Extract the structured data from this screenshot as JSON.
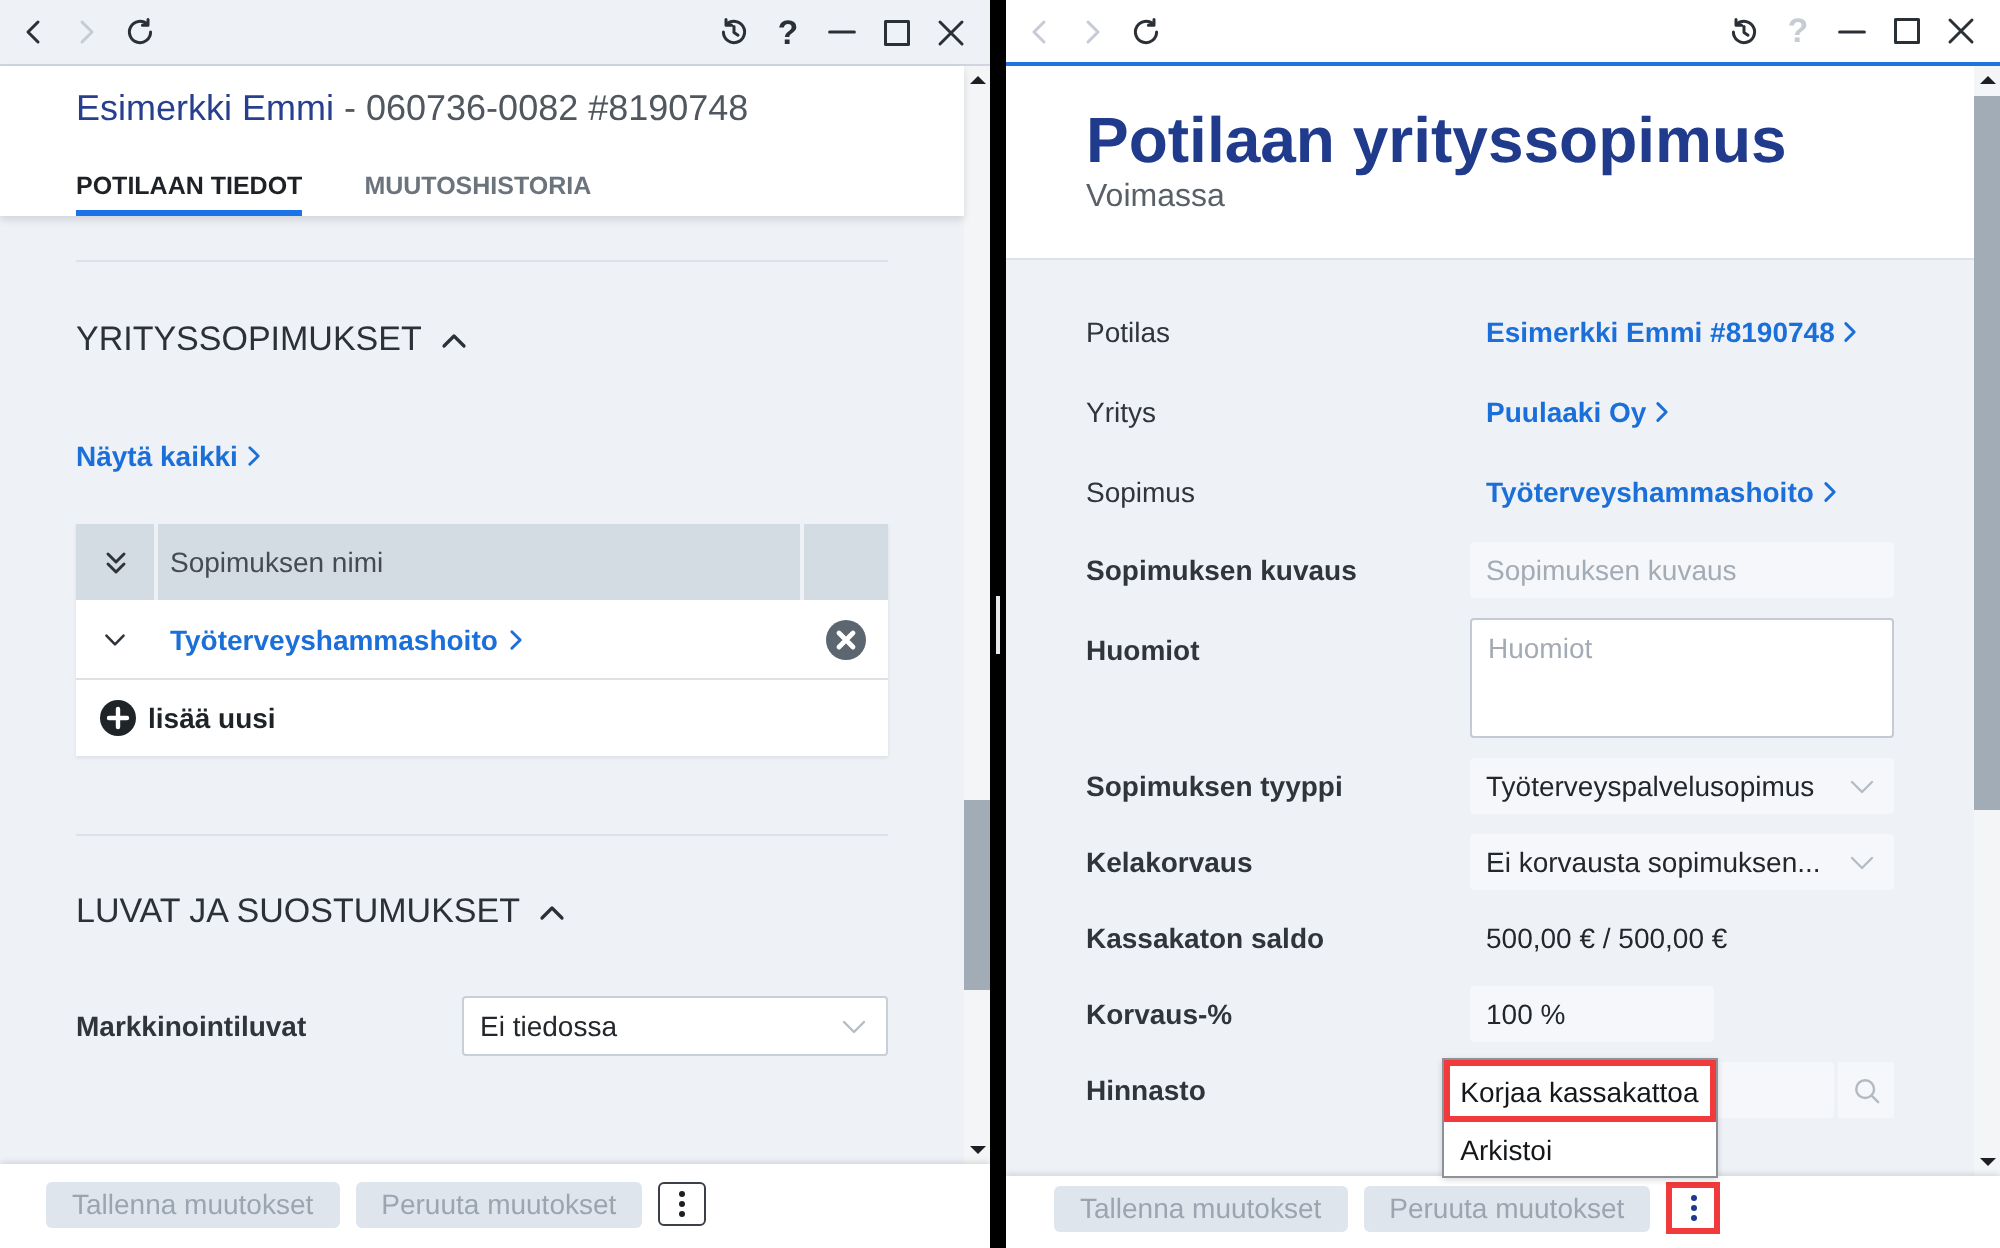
{
  "left_window": {
    "focused": false,
    "toolbar": {
      "nav": [
        {
          "kind": "back",
          "disabled": false
        },
        {
          "kind": "forward",
          "disabled": true
        },
        {
          "kind": "reload",
          "disabled": false
        }
      ],
      "controls": [
        {
          "kind": "history",
          "disabled": false
        },
        {
          "kind": "help",
          "label": "?",
          "disabled": false
        },
        {
          "kind": "minimize",
          "disabled": false
        },
        {
          "kind": "maximize",
          "disabled": false
        },
        {
          "kind": "close",
          "disabled": false
        }
      ]
    },
    "header": {
      "name": "Esimerkki Emmi",
      "details": "- 060736-0082 #8190748"
    },
    "tabs": [
      {
        "label": "POTILAAN TIEDOT",
        "selected": true
      },
      {
        "label": "MUUTOSHISTORIA",
        "selected": false
      }
    ],
    "contracts_section": {
      "title": "YRITYSSOPIMUKSET",
      "expanded": true,
      "show_all_link": "Näytä kaikki",
      "table": {
        "columns": [
          "Sopimuksen nimi"
        ],
        "rows": [
          {
            "name": "Työterveyshammashoito",
            "expanded": false
          }
        ],
        "add_button": "lisää uusi"
      }
    },
    "permissions_section": {
      "title": "LUVAT JA SUOSTUMUKSET",
      "expanded": true,
      "fields": [
        {
          "label": "Markkinointiluvat",
          "value": "Ei tiedossa"
        }
      ]
    },
    "footer": {
      "buttons": [
        {
          "label": "Tallenna muutokset",
          "disabled": true
        },
        {
          "label": "Peruuta muutokset",
          "disabled": true
        }
      ],
      "more_button": {
        "highlighted": false
      }
    }
  },
  "right_window": {
    "focused": true,
    "toolbar": {
      "nav": [
        {
          "kind": "back",
          "disabled": true
        },
        {
          "kind": "forward",
          "disabled": true
        },
        {
          "kind": "reload",
          "disabled": false
        }
      ],
      "controls": [
        {
          "kind": "history",
          "disabled": false
        },
        {
          "kind": "help",
          "label": "?",
          "disabled": true
        },
        {
          "kind": "minimize",
          "disabled": false
        },
        {
          "kind": "maximize",
          "disabled": false
        },
        {
          "kind": "close",
          "disabled": false
        }
      ]
    },
    "header": {
      "title": "Potilaan yrityssopimus",
      "status": "Voimassa"
    },
    "fields": [
      {
        "kind": "link",
        "label": "Potilas",
        "value": "Esimerkki Emmi #8190748"
      },
      {
        "kind": "link",
        "label": "Yritys",
        "value": "Puulaaki Oy"
      },
      {
        "kind": "link",
        "label": "Sopimus",
        "value": "Työterveyshammashoito"
      },
      {
        "kind": "input",
        "label": "Sopimuksen kuvaus",
        "placeholder": "Sopimuksen kuvaus"
      },
      {
        "kind": "textarea",
        "label": "Huomiot",
        "placeholder": "Huomiot"
      },
      {
        "kind": "select",
        "label": "Sopimuksen tyyppi",
        "value": "Työterveyspalvelusopimus"
      },
      {
        "kind": "select",
        "label": "Kelakorvaus",
        "value": "Ei korvausta sopimuksen..."
      },
      {
        "kind": "text",
        "label": "Kassakaton saldo",
        "value": "500,00 € / 500,00 €"
      },
      {
        "kind": "short_input",
        "label": "Korvaus-%",
        "value": "100 %"
      },
      {
        "kind": "search",
        "label": "Hinnasto"
      }
    ],
    "footer": {
      "buttons": [
        {
          "label": "Tallenna muutokset",
          "disabled": true
        },
        {
          "label": "Peruuta muutokset",
          "disabled": true
        }
      ],
      "more_button": {
        "highlighted": true
      },
      "menu": {
        "items": [
          {
            "label": "Korjaa kassakattoa",
            "highlighted": true
          },
          {
            "label": "Arkistoi",
            "highlighted": false
          }
        ]
      }
    }
  }
}
